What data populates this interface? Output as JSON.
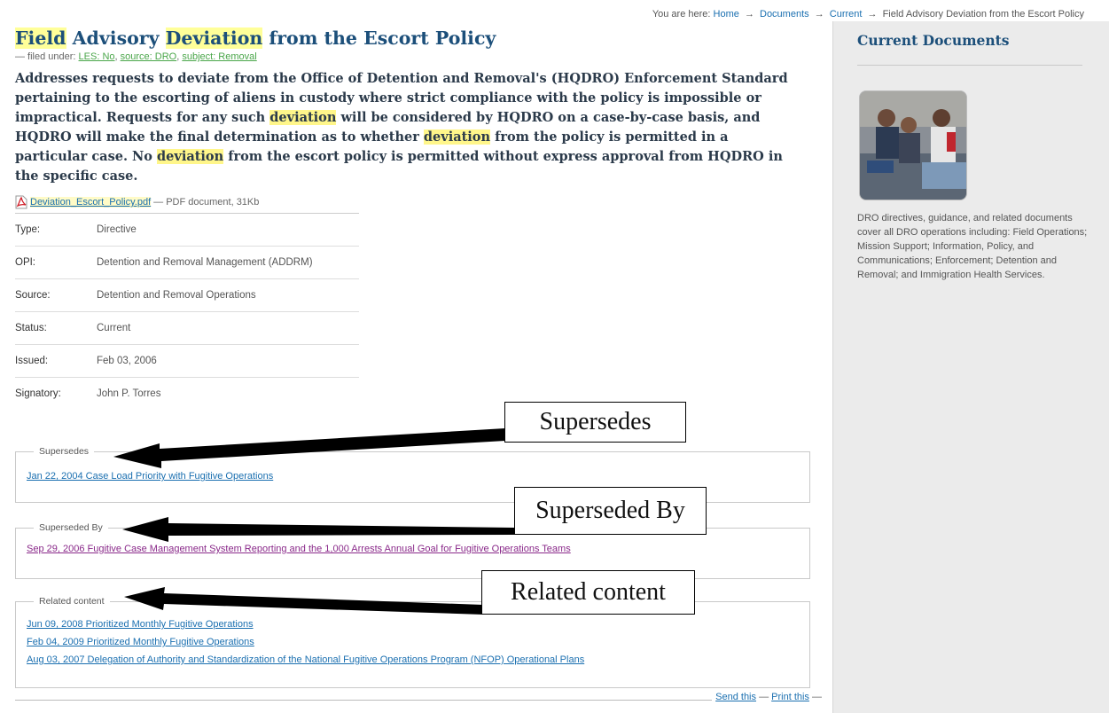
{
  "breadcrumb": {
    "prefix": "You are here:",
    "items": [
      "Home",
      "Documents",
      "Current"
    ],
    "current": "Field Advisory Deviation from the Escort Policy",
    "separator": "→"
  },
  "page": {
    "title_parts": [
      {
        "text": "Field",
        "highlight": true
      },
      {
        "text": " Advisory ",
        "highlight": false
      },
      {
        "text": "Deviation",
        "highlight": true
      },
      {
        "text": " from the Escort Policy",
        "highlight": false
      }
    ],
    "filed_under_prefix": "— filed under:",
    "tags": [
      "LES: No",
      "source: DRO",
      "subject: Removal"
    ],
    "description_parts": [
      {
        "text": "Addresses requests to deviate from the Office of Detention and Removal's (HQDRO) Enforcement Standard pertaining to the escorting of aliens in custody where strict compliance with the policy is impossible or impractical. Requests for any such ",
        "highlight": false
      },
      {
        "text": "deviation",
        "highlight": true
      },
      {
        "text": " will be considered by HQDRO on a case-by-case basis, and HQDRO will make the final determination as to whether ",
        "highlight": false
      },
      {
        "text": "deviation",
        "highlight": true
      },
      {
        "text": " from the policy is permitted in a particular case. No ",
        "highlight": false
      },
      {
        "text": "deviation",
        "highlight": true
      },
      {
        "text": " from the escort policy is permitted without express approval from HQDRO in the specific case.",
        "highlight": false
      }
    ]
  },
  "attachment": {
    "filename": "Deviation_Escort_Policy.pdf",
    "info": "— PDF document, 31Kb",
    "icon": "pdf-icon"
  },
  "meta": [
    {
      "key": "Type:",
      "value": "Directive"
    },
    {
      "key": "OPI:",
      "value": "Detention and Removal Management (ADDRM)"
    },
    {
      "key": "Source:",
      "value": "Detention and Removal Operations"
    },
    {
      "key": "Status:",
      "value": "Current"
    },
    {
      "key": "Issued:",
      "value": "Feb 03, 2006"
    },
    {
      "key": "Signatory:",
      "value": "John P. Torres"
    }
  ],
  "supersedes": {
    "legend": "Supersedes",
    "links": [
      "Jan 22, 2004 Case Load Priority with Fugitive Operations"
    ]
  },
  "superseded_by": {
    "legend": "Superseded By",
    "links": [
      "Sep 29, 2006 Fugitive Case Management System Reporting and the 1,000 Arrests Annual Goal for Fugitive Operations Teams"
    ]
  },
  "related": {
    "legend": "Related content",
    "links": [
      "Jun 09, 2008 Prioritized Monthly Fugitive Operations",
      "Feb 04, 2009 Prioritized Monthly Fugitive Operations",
      "Aug 03, 2007 Delegation of Authority and Standardization of the National Fugitive Operations Program (NFOP) Operational Plans"
    ]
  },
  "share": {
    "send": "Send this",
    "print": "Print this",
    "dash": "—"
  },
  "sidebar": {
    "title": "Current Documents",
    "blurb": "DRO directives, guidance, and related documents cover all DRO operations including: Field Operations; Mission Support; Information, Policy, and Communications; Enforcement; Detention and Removal; and Immigration Health Services."
  },
  "callouts": {
    "supersedes": "Supersedes",
    "superseded_by": "Superseded By",
    "related": "Related content"
  },
  "colors": {
    "link": "#1a6fb0",
    "title": "#1c4f7a",
    "highlight": "#ffff99",
    "sidebar_bg": "#ebebeb"
  }
}
